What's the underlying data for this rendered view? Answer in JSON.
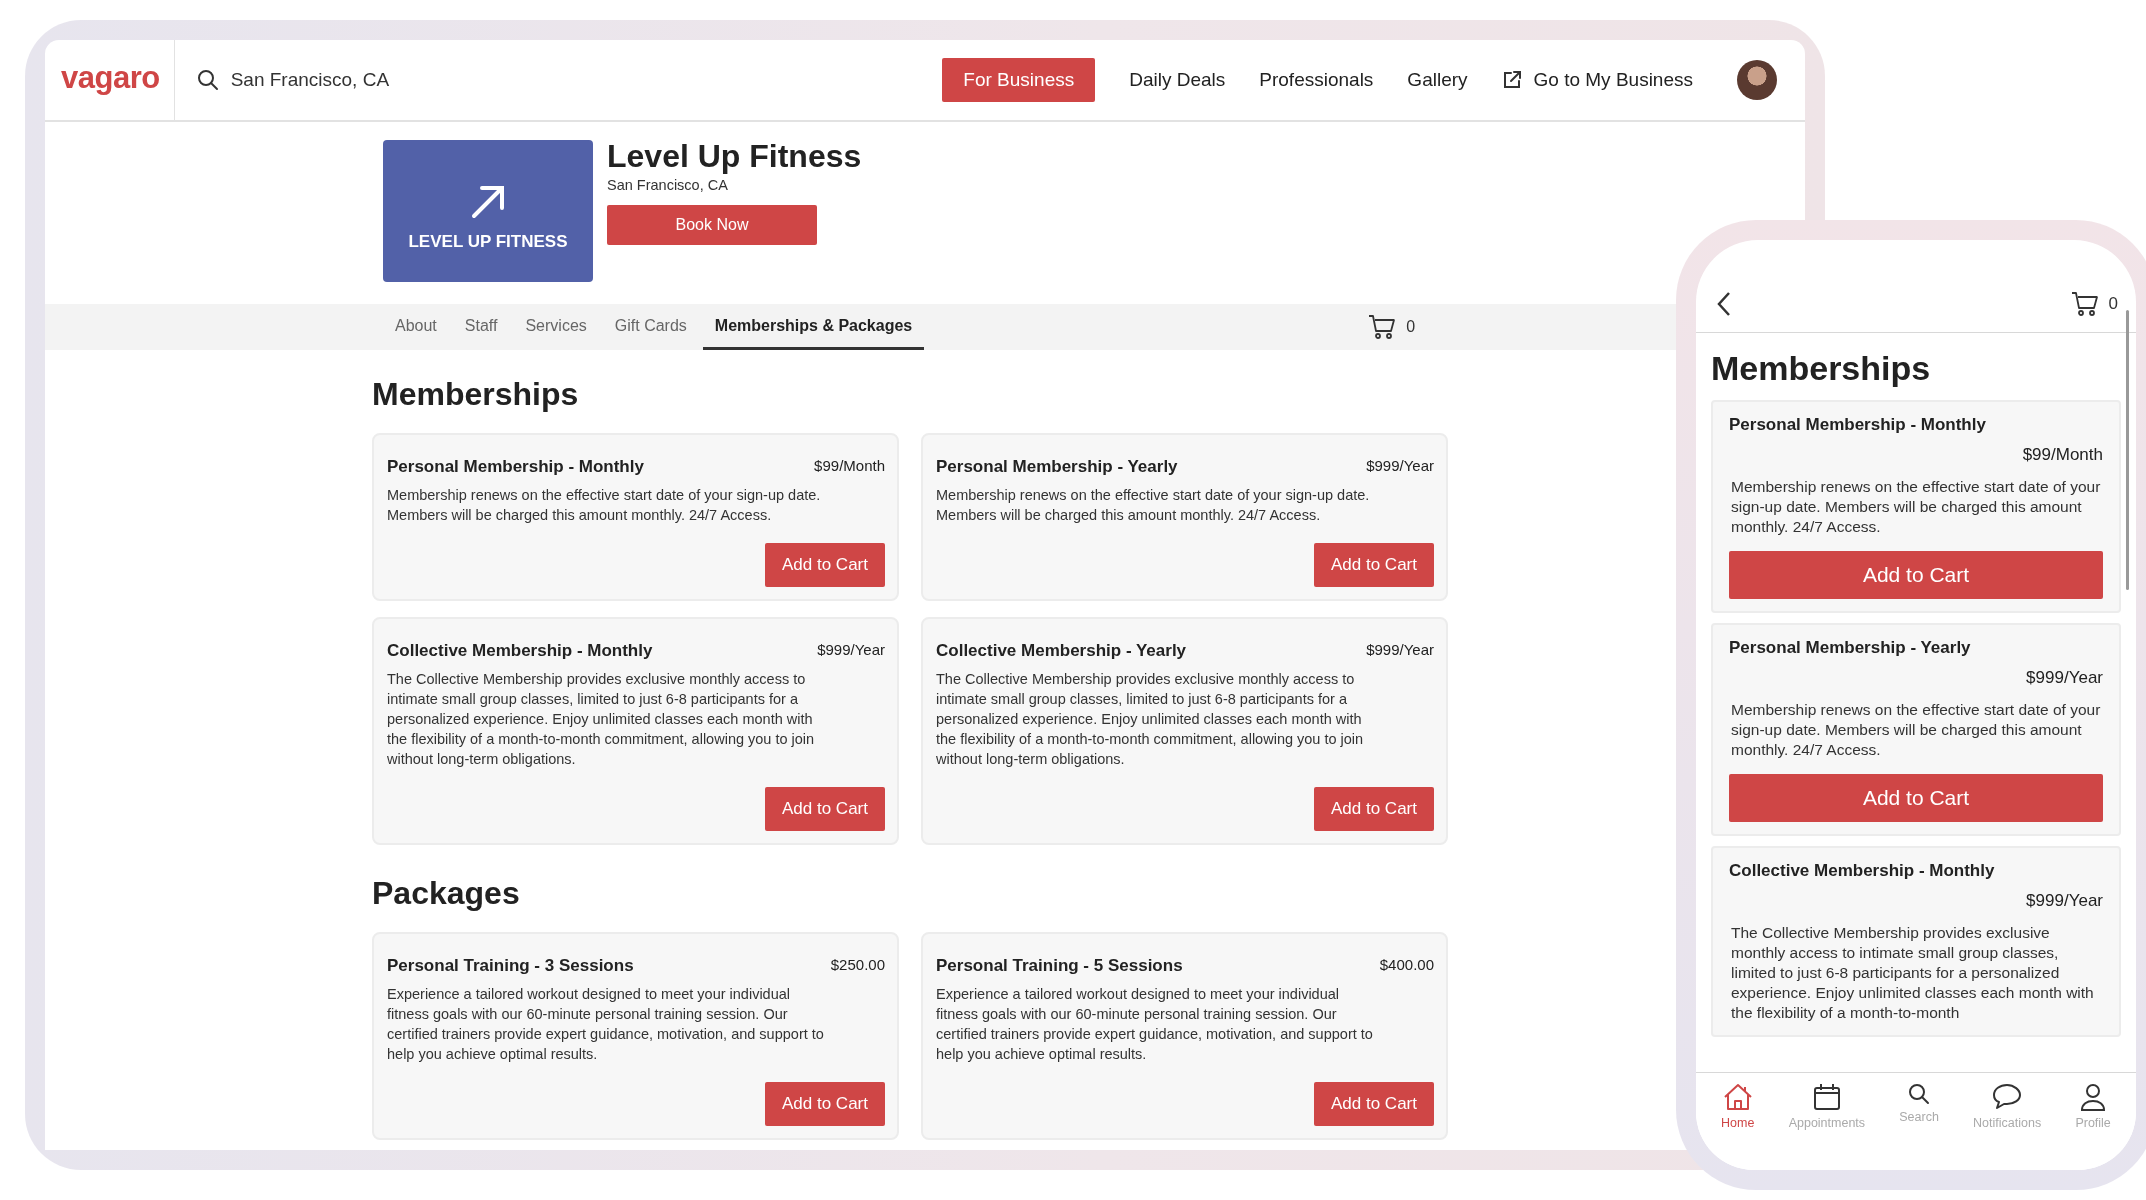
{
  "header": {
    "logo": "vagaro",
    "search": {
      "value": "San Francisco, CA"
    },
    "nav": [
      {
        "label": "For Business",
        "kind": "primary"
      },
      {
        "label": "Daily Deals",
        "kind": "link"
      },
      {
        "label": "Professionals",
        "kind": "link"
      },
      {
        "label": "Gallery",
        "kind": "link"
      },
      {
        "label": "Go to My Business",
        "kind": "external"
      }
    ]
  },
  "business": {
    "logo_text": "LEVEL UP FITNESS",
    "name": "Level Up Fitness",
    "location": "San Francisco, CA",
    "book_button": "Book Now"
  },
  "tabs": [
    {
      "label": "About",
      "selected": false
    },
    {
      "label": "Staff",
      "selected": false
    },
    {
      "label": "Services",
      "selected": false
    },
    {
      "label": "Gift Cards",
      "selected": false
    },
    {
      "label": "Memberships & Packages",
      "selected": true
    }
  ],
  "cart_count": "0",
  "sections": [
    {
      "title": "Memberships",
      "items": [
        {
          "name": "Personal Membership - Monthly",
          "price": "$99/Month",
          "description": "Membership renews on the effective start date of your sign-up date. Members will be charged this amount monthly. 24/7 Access.",
          "button": "Add to Cart"
        },
        {
          "name": "Personal Membership - Yearly",
          "price": "$999/Year",
          "description": "Membership renews on the effective start date of your sign-up date. Members will be charged this amount monthly. 24/7 Access.",
          "button": "Add to Cart"
        },
        {
          "name": "Collective Membership - Monthly",
          "price": "$999/Year",
          "description": "The Collective Membership provides exclusive monthly access to intimate small group classes, limited to just 6-8 participants for a personalized experience. Enjoy unlimited classes each month with the flexibility of a month-to-month commitment, allowing you to join without long-term obligations.",
          "button": "Add to Cart"
        },
        {
          "name": "Collective Membership - Yearly",
          "price": "$999/Year",
          "description": "The Collective Membership provides exclusive monthly access to intimate small group classes, limited to just 6-8 participants for a personalized experience. Enjoy unlimited classes each month with the flexibility of a month-to-month commitment, allowing you to join without long-term obligations.",
          "button": "Add to Cart"
        }
      ]
    },
    {
      "title": "Packages",
      "items": [
        {
          "name": "Personal Training - 3 Sessions",
          "price": "$250.00",
          "description": "Experience a tailored workout designed to meet your individual fitness goals with our 60-minute personal training session. Our certified trainers provide expert guidance, motivation, and support to help you achieve optimal results.",
          "button": "Add to Cart"
        },
        {
          "name": "Personal Training - 5 Sessions",
          "price": "$400.00",
          "description": "Experience a tailored workout designed to meet your individual fitness goals with our 60-minute personal training session. Our certified trainers provide expert guidance, motivation, and support to help you achieve optimal results.",
          "button": "Add to Cart"
        }
      ]
    }
  ],
  "phone": {
    "cart_count": "0",
    "title": "Memberships",
    "items": [
      {
        "name": "Personal Membership - Monthly",
        "price": "$99/Month",
        "description": "Membership renews on the effective start date of your sign-up date. Members will be charged this amount monthly. 24/7 Access.",
        "button": "Add to Cart"
      },
      {
        "name": "Personal Membership - Yearly",
        "price": "$999/Year",
        "description": "Membership renews on the effective start date of your sign-up date. Members will be charged this amount monthly. 24/7 Access.",
        "button": "Add to Cart"
      },
      {
        "name": "Collective Membership - Monthly",
        "price": "$999/Year",
        "description": "The Collective Membership provides exclusive monthly access to intimate small group classes, limited to just 6-8 participants for a personalized experience. Enjoy unlimited classes each month with the flexibility of a month-to-month"
      }
    ],
    "nav": [
      {
        "label": "Home",
        "kind": "home",
        "selected": true
      },
      {
        "label": "Appointments",
        "kind": "calendar",
        "selected": false
      },
      {
        "label": "Search",
        "kind": "search",
        "selected": false
      },
      {
        "label": "Notifications",
        "kind": "chat",
        "selected": false
      },
      {
        "label": "Profile",
        "kind": "person",
        "selected": false
      }
    ]
  }
}
